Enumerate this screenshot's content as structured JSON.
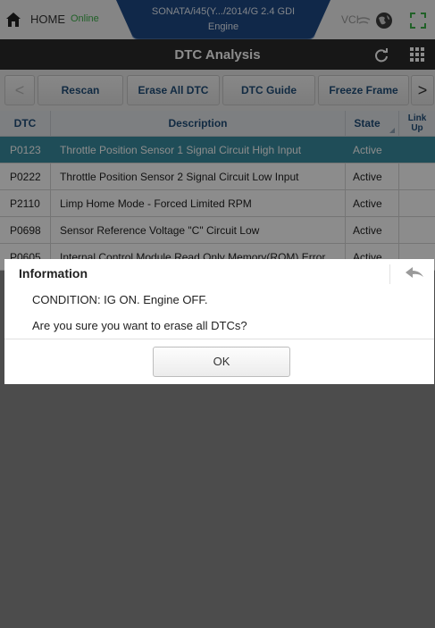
{
  "status_bar": {
    "home_label": "HOME",
    "connection_status": "Online",
    "vehicle_model": "SONATA/i45(Y.../2014/G 2.4 GDI",
    "vehicle_system": "Engine",
    "vci_label": "VCI"
  },
  "title_bar": {
    "title": "DTC Analysis"
  },
  "toolbar": {
    "prev_label": "<",
    "rescan_label": "Rescan",
    "erase_all_label": "Erase All DTC",
    "dtc_guide_label": "DTC Guide",
    "freeze_frame_label": "Freeze Frame",
    "next_label": ">"
  },
  "table": {
    "columns": {
      "dtc": "DTC",
      "description": "Description",
      "state": "State",
      "link_up": "Link Up"
    },
    "rows": [
      {
        "code": "P0123",
        "description": "Throttle Position Sensor 1 Signal Circuit High Input",
        "state": "Active"
      },
      {
        "code": "P0222",
        "description": "Throttle Position Sensor 2 Signal Circuit Low Input",
        "state": "Active"
      },
      {
        "code": "P2110",
        "description": "Limp Home Mode - Forced Limited RPM",
        "state": "Active"
      },
      {
        "code": "P0698",
        "description": "Sensor Reference Voltage \"C\" Circuit Low",
        "state": "Active"
      },
      {
        "code": "P0605",
        "description": "Internal Control Module Read Only Memory(ROM) Error",
        "state": "Active"
      }
    ]
  },
  "dialog": {
    "title": "Information",
    "line1": "CONDITION: IG ON. Engine OFF.",
    "line2": "Are you sure you want to erase all DTCs?",
    "ok_label": "OK"
  },
  "colors": {
    "online": "#3db14a",
    "title_bar": "#2b2b2b",
    "vehicle_banner": "#1e4a86",
    "selected_row": "#3a8da0",
    "header_text": "#1f4e79"
  }
}
